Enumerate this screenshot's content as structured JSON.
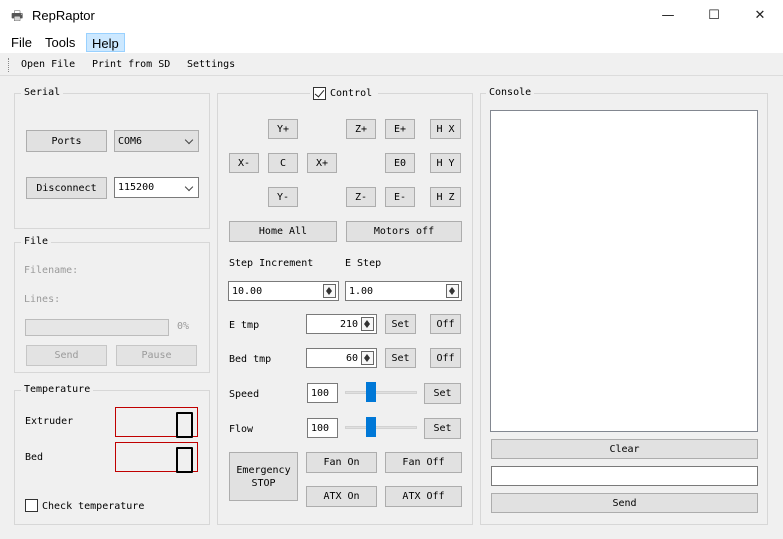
{
  "window": {
    "title": "RepRaptor",
    "app_icon": "printer-icon",
    "controls": {
      "minimize": "—",
      "maximize": "☐",
      "close": "✕"
    }
  },
  "menu": {
    "file": "File",
    "tools": "Tools",
    "help": "Help"
  },
  "toolbar": {
    "open_file": "Open File",
    "print_from_sd": "Print from SD",
    "settings": "Settings"
  },
  "serial": {
    "title": "Serial",
    "ports_button": "Ports",
    "port_value": "COM6",
    "disconnect_button": "Disconnect",
    "baud_value": "115200"
  },
  "file": {
    "title": "File",
    "filename_label": "Filename:",
    "lines_label": "Lines:",
    "progress_value": 0,
    "progress_text": "0%",
    "send_button": "Send",
    "pause_button": "Pause"
  },
  "temperature": {
    "title": "Temperature",
    "extruder_label": "Extruder",
    "extruder_value": "0",
    "bed_label": "Bed",
    "bed_value": "0",
    "check_label": "Check temperature",
    "check_checked": false
  },
  "control": {
    "title": "Control",
    "checked": true,
    "y_plus": "Y+",
    "y_minus": "Y-",
    "x_minus": "X-",
    "center": "C",
    "x_plus": "X+",
    "z_plus": "Z+",
    "z_minus": "Z-",
    "e_plus": "E+",
    "e_zero": "E0",
    "e_minus": "E-",
    "home_x": "H X",
    "home_y": "H Y",
    "home_z": "H Z",
    "home_all": "Home All",
    "motors_off": "Motors off",
    "step_increment_label": "Step Increment",
    "e_step_label": "E Step",
    "step_increment_value": "10.00",
    "e_step_value": "1.00",
    "e_tmp_label": "E tmp",
    "e_tmp_value": "210",
    "e_tmp_set": "Set",
    "e_tmp_off": "Off",
    "bed_tmp_label": "Bed tmp",
    "bed_tmp_value": "60",
    "bed_tmp_set": "Set",
    "bed_tmp_off": "Off",
    "speed_label": "Speed",
    "speed_value": "100",
    "speed_set": "Set",
    "flow_label": "Flow",
    "flow_value": "100",
    "flow_set": "Set",
    "emergency_line1": "Emergency",
    "emergency_line2": "STOP",
    "fan_on": "Fan On",
    "fan_off": "Fan Off",
    "atx_on": "ATX On",
    "atx_off": "ATX Off"
  },
  "console": {
    "title": "Console",
    "output": "",
    "clear_button": "Clear",
    "input_value": "",
    "send_button": "Send"
  },
  "colors": {
    "accent": "#0078d7",
    "lcd_border": "#c00000",
    "menu_highlight": "#cce8ff"
  }
}
